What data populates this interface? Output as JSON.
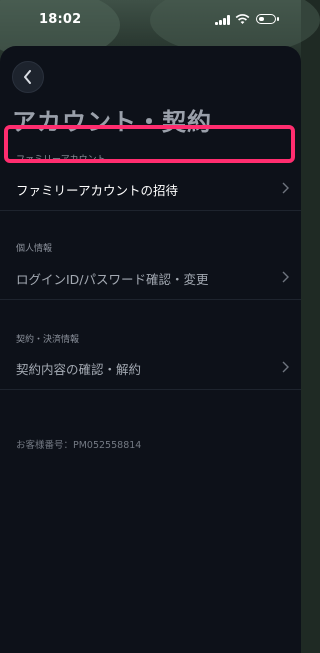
{
  "status_bar": {
    "time": "18:02"
  },
  "page": {
    "title": "アカウント・契約"
  },
  "sections": [
    {
      "header": "ファミリーアカウント",
      "item": "ファミリーアカウントの招待"
    },
    {
      "header": "個人情報",
      "item": "ログインID/パスワード確認・変更"
    },
    {
      "header": "契約・決済情報",
      "item": "契約内容の確認・解約"
    }
  ],
  "customer_number": "お客様番号：PM052558814",
  "colors": {
    "highlight": "#ff2d6f",
    "background": "#0d1119"
  },
  "icons": [
    "back-arrow-icon",
    "chevron-right-icon",
    "signal-icon",
    "wifi-icon",
    "battery-icon"
  ]
}
